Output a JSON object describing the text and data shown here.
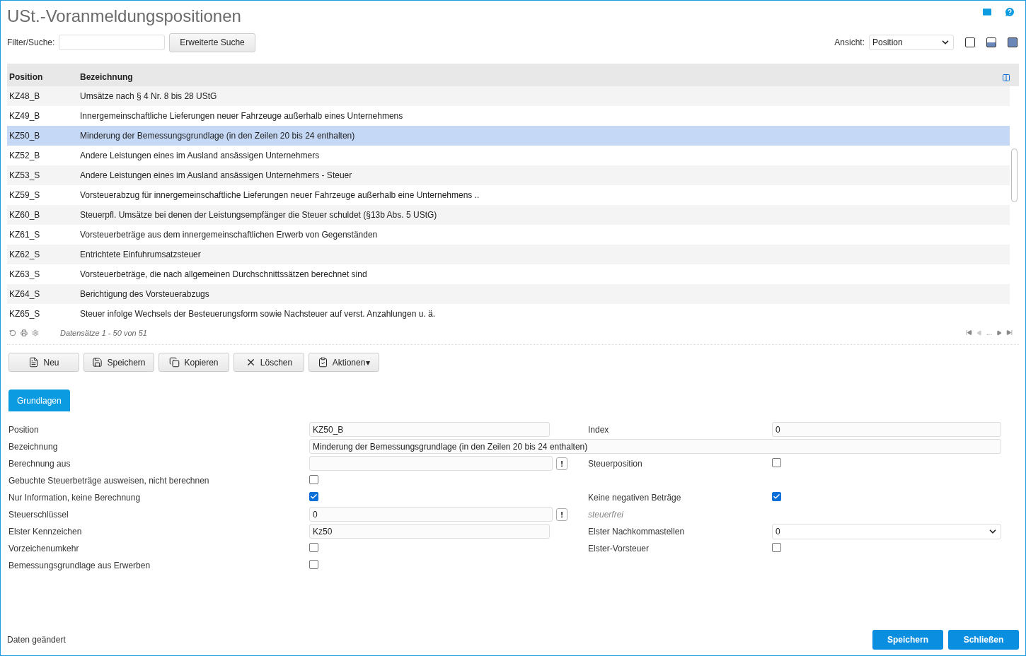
{
  "title": "USt.-Voranmeldungspositionen",
  "filter": {
    "label": "Filter/Suche:",
    "button": "Erweiterte Suche"
  },
  "view": {
    "label": "Ansicht:",
    "value": "Position"
  },
  "table": {
    "columns": [
      "Position",
      "Bezeichnung"
    ],
    "rows": [
      {
        "position": "KZ48_B",
        "bezeichnung": "Umsätze nach § 4 Nr. 8 bis 28 UStG",
        "selected": false
      },
      {
        "position": "KZ49_B",
        "bezeichnung": "Innergemeinschaftliche Lieferungen neuer Fahrzeuge außerhalb eines Unternehmens",
        "selected": false
      },
      {
        "position": "KZ50_B",
        "bezeichnung": "Minderung der Bemessungsgrundlage (in den Zeilen 20 bis 24 enthalten)",
        "selected": true
      },
      {
        "position": "KZ52_B",
        "bezeichnung": "Andere Leistungen eines im Ausland ansässigen Unternehmers",
        "selected": false
      },
      {
        "position": "KZ53_S",
        "bezeichnung": "Andere Leistungen eines im Ausland ansässigen Unternehmers - Steuer",
        "selected": false
      },
      {
        "position": "KZ59_S",
        "bezeichnung": "Vorsteuerabzug für innergemeinschaftliche Lieferungen neuer Fahrzeuge außerhalb eine Unternehmens ..",
        "selected": false
      },
      {
        "position": "KZ60_B",
        "bezeichnung": "Steuerpfl. Umsätze bei denen der Leistungsempfänger die Steuer schuldet (§13b Abs. 5 UStG)",
        "selected": false
      },
      {
        "position": "KZ61_S",
        "bezeichnung": "Vorsteuerbeträge aus dem innergemeinschaftlichen Erwerb von Gegenständen",
        "selected": false
      },
      {
        "position": "KZ62_S",
        "bezeichnung": "Entrichtete Einfuhrumsatzsteuer",
        "selected": false
      },
      {
        "position": "KZ63_S",
        "bezeichnung": "Vorsteuerbeträge, die nach allgemeinen Durchschnittssätzen berechnet sind",
        "selected": false
      },
      {
        "position": "KZ64_S",
        "bezeichnung": "Berichtigung des Vorsteuerabzugs",
        "selected": false
      },
      {
        "position": "KZ65_S",
        "bezeichnung": "Steuer infolge Wechsels der Besteuerungsform sowie Nachsteuer auf verst. Anzahlungen u. ä.",
        "selected": false
      }
    ],
    "records": "Datensätze 1 - 50 von 51",
    "pager_gap": "..."
  },
  "actions": [
    {
      "kind": "new",
      "label": "Neu"
    },
    {
      "kind": "save",
      "label": "Speichern"
    },
    {
      "kind": "copy",
      "label": "Kopieren"
    },
    {
      "kind": "delete",
      "label": "Löschen"
    },
    {
      "kind": "actions",
      "label": "Aktionen",
      "caret": "▾"
    }
  ],
  "tabs": [
    {
      "label": "Grundlagen",
      "selected": true
    }
  ],
  "form": [
    {
      "left": {
        "label": "Position",
        "kind": "text",
        "value": "KZ50_B"
      },
      "right": {
        "label": "Index",
        "kind": "text",
        "value": "0"
      }
    },
    {
      "left": {
        "label": "Bezeichnung",
        "kind": "wide",
        "value": "Minderung der Bemessungsgrundlage (in den Zeilen 20 bis 24 enthalten)"
      }
    },
    {
      "left": {
        "label": "Berechnung aus",
        "kind": "lookup",
        "button": "!"
      },
      "right": {
        "label": "Steuerposition",
        "kind": "checkbox",
        "checked": false
      }
    },
    {
      "left": {
        "label": "Gebuchte Steuerbeträge ausweisen, nicht berechnen",
        "kind": "checkbox",
        "checked": false
      }
    },
    {
      "left": {
        "label": "Nur Information, keine Berechnung",
        "kind": "checkbox",
        "checked": true
      },
      "right": {
        "label": "Keine negativen Beträge",
        "kind": "checkbox",
        "checked": true
      }
    },
    {
      "left": {
        "label": "Steuerschlüssel",
        "kind": "lookup",
        "value": "0",
        "button": "!"
      },
      "right": {
        "kind": "note",
        "text": "steuerfrei"
      }
    },
    {
      "left": {
        "label": "Elster Kennzeichen",
        "kind": "text",
        "value": "Kz50"
      },
      "right": {
        "label": "Elster Nachkommastellen",
        "kind": "select",
        "value": "0"
      }
    },
    {
      "left": {
        "label": "Vorzeichenumkehr",
        "kind": "checkbox",
        "checked": false
      },
      "right": {
        "label": "Elster-Vorsteuer",
        "kind": "checkbox",
        "checked": false
      }
    },
    {
      "left": {
        "label": "Bemessungsgrundlage aus Erwerben",
        "kind": "checkbox",
        "checked": false
      }
    }
  ],
  "status": "Daten geändert",
  "footer_buttons": [
    "Speichern",
    "Schließen"
  ]
}
